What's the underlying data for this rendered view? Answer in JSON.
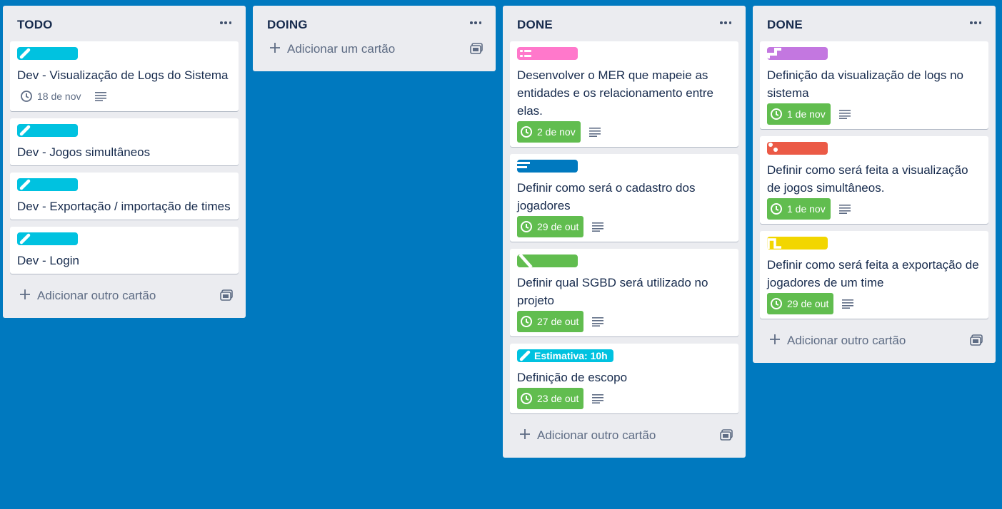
{
  "board": {
    "lists": [
      {
        "title": "TODO",
        "cards": [
          {
            "title": "Dev - Visualização de Logs do Sistema",
            "label_color": "#00c2e0",
            "label_icon": "pencil-icon",
            "due": "18 de nov",
            "due_done": false
          },
          {
            "title": "Dev - Jogos simultâneos",
            "label_color": "#00c2e0",
            "label_icon": "pencil-icon"
          },
          {
            "title": "Dev - Exportação / importação de times",
            "label_color": "#00c2e0",
            "label_icon": "pencil-icon"
          },
          {
            "title": "Dev - Login",
            "label_color": "#00c2e0",
            "label_icon": "pencil-icon"
          }
        ],
        "add_label": "Adicionar outro cartão"
      },
      {
        "title": "DOING",
        "cards": [],
        "add_label": "Adicionar um cartão"
      },
      {
        "title": "DONE",
        "cards": [
          {
            "title": "Desenvolver o MER que mapeie as entidades e os relacionamento entre elas.",
            "label_color": "#ff78cb",
            "label_icon": "entity-icon",
            "due": "2 de nov",
            "due_done": true
          },
          {
            "title": "Definir como será o cadastro dos jogadores",
            "label_color": "#0079bf",
            "label_icon": "form-icon",
            "due": "29 de out",
            "due_done": true
          },
          {
            "title": "Definir qual SGBD será utilizado no projeto",
            "label_color": "#61bd4f",
            "label_icon": "stripe-icon",
            "due": "27 de out",
            "due_done": true
          },
          {
            "title": "Definição de escopo",
            "label_color": "#00c2e0",
            "label_icon": "pencil-icon",
            "label_text": "Estimativa: 10h",
            "due": "23 de out",
            "due_done": true
          }
        ],
        "add_label": "Adicionar outro cartão"
      },
      {
        "title": "DONE",
        "cards": [
          {
            "title": "Definição da visualização de logs no sistema",
            "label_color": "#c377e0",
            "label_icon": "flow-icon",
            "due": "1 de nov",
            "due_done": true
          },
          {
            "title": "Definir como será feita a visualização de jogos simultâneos.",
            "label_color": "#eb5a46",
            "label_icon": "dots-icon",
            "due": "1 de nov",
            "due_done": true
          },
          {
            "title": "Definir como será feita a exportação de jogadores de um time",
            "label_color": "#f2d600",
            "label_icon": "wave-icon",
            "due": "29 de out",
            "due_done": true
          }
        ],
        "add_label": "Adicionar outro cartão"
      }
    ]
  }
}
